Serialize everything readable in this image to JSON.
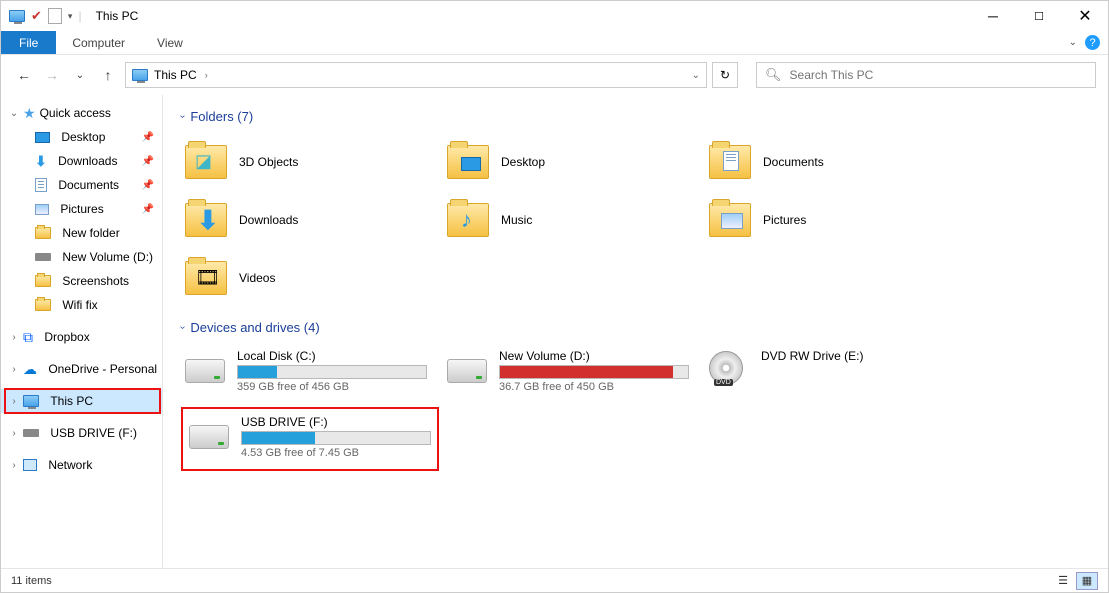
{
  "titlebar": {
    "title": "This PC"
  },
  "menubar": {
    "file": "File",
    "tabs": [
      "Computer",
      "View"
    ]
  },
  "addressbar": {
    "crumb": "This PC"
  },
  "search": {
    "placeholder": "Search This PC"
  },
  "sidebar": {
    "quick_access": {
      "label": "Quick access",
      "items": [
        {
          "label": "Desktop",
          "pinned": true
        },
        {
          "label": "Downloads",
          "pinned": true
        },
        {
          "label": "Documents",
          "pinned": true
        },
        {
          "label": "Pictures",
          "pinned": true
        },
        {
          "label": "New folder"
        },
        {
          "label": "New Volume (D:)"
        },
        {
          "label": "Screenshots"
        },
        {
          "label": "Wifi fix"
        }
      ]
    },
    "dropbox": "Dropbox",
    "onedrive": "OneDrive - Personal",
    "thispc": "This PC",
    "usb": "USB DRIVE (F:)",
    "network": "Network"
  },
  "folders": {
    "header": "Folders (7)",
    "items": [
      "3D Objects",
      "Desktop",
      "Documents",
      "Downloads",
      "Music",
      "Pictures",
      "Videos"
    ]
  },
  "drives": {
    "header": "Devices and drives (4)",
    "items": [
      {
        "name": "Local Disk (C:)",
        "free": "359 GB free of 456 GB",
        "fill": 21,
        "color": "#26a0da"
      },
      {
        "name": "New Volume (D:)",
        "free": "36.7 GB free of 450 GB",
        "fill": 92,
        "color": "#d22f2f"
      },
      {
        "name": "DVD RW Drive (E:)"
      },
      {
        "name": "USB DRIVE (F:)",
        "free": "4.53 GB free of 7.45 GB",
        "fill": 39,
        "color": "#26a0da",
        "highlight": true
      }
    ]
  },
  "statusbar": {
    "text": "11 items"
  }
}
